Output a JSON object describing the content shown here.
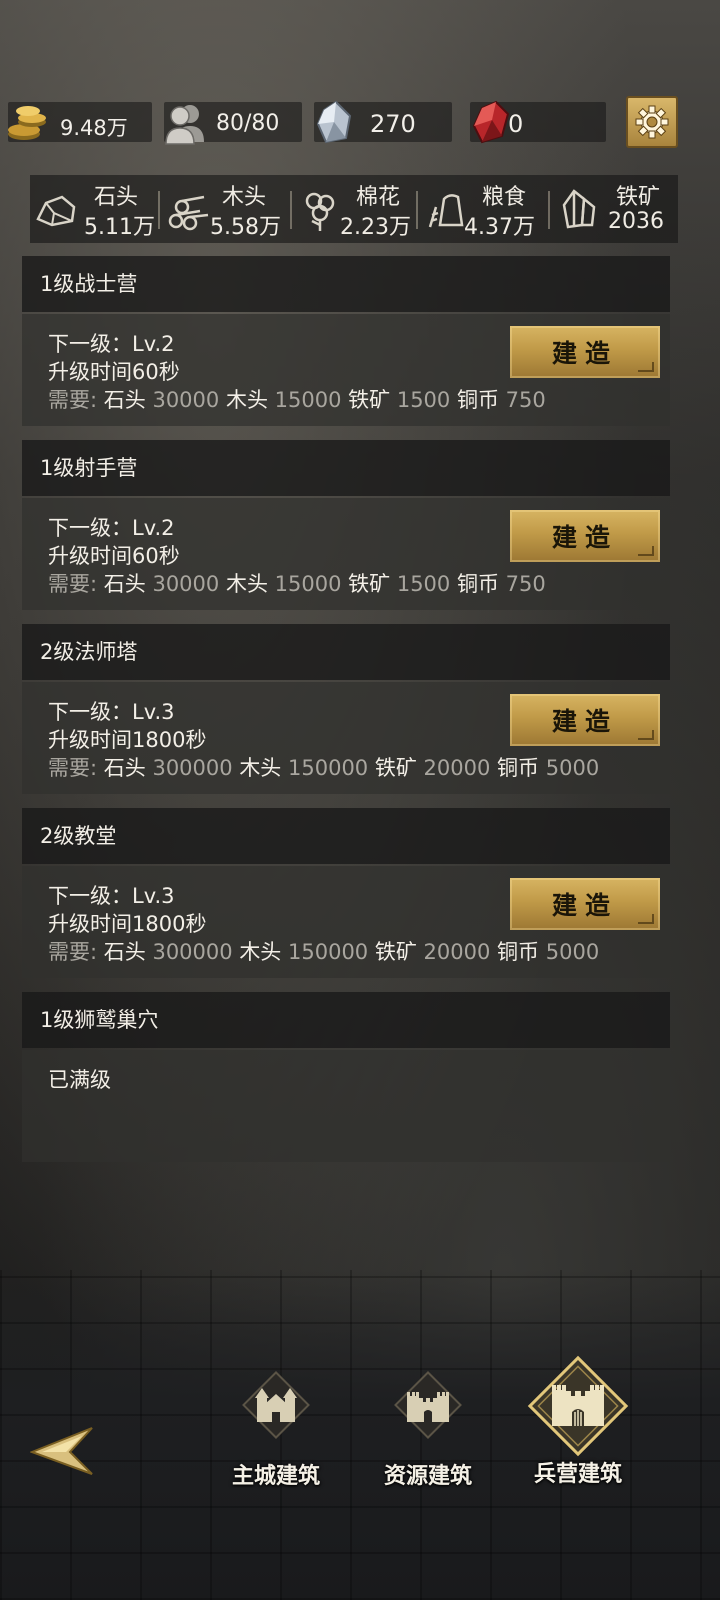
{
  "resources": {
    "coins": "9.48万",
    "population": "80/80",
    "crystal": "270",
    "ruby": "0"
  },
  "materials": [
    {
      "name": "石头",
      "value": "5.11万"
    },
    {
      "name": "木头",
      "value": "5.58万"
    },
    {
      "name": "棉花",
      "value": "2.23万"
    },
    {
      "name": "粮食",
      "value": "4.37万"
    },
    {
      "name": "铁矿",
      "value": "2036"
    }
  ],
  "buildings": [
    {
      "title": "1级战士营",
      "next": "下一级：Lv.2",
      "time": "升级时间60秒",
      "req_label": "需要:",
      "req": [
        [
          "石头",
          "30000"
        ],
        [
          "木头",
          "15000"
        ],
        [
          "铁矿",
          "1500"
        ],
        [
          "铜币",
          "750"
        ]
      ],
      "button": "建造"
    },
    {
      "title": "1级射手营",
      "next": "下一级：Lv.2",
      "time": "升级时间60秒",
      "req_label": "需要:",
      "req": [
        [
          "石头",
          "30000"
        ],
        [
          "木头",
          "15000"
        ],
        [
          "铁矿",
          "1500"
        ],
        [
          "铜币",
          "750"
        ]
      ],
      "button": "建造"
    },
    {
      "title": "2级法师塔",
      "next": "下一级：Lv.3",
      "time": "升级时间1800秒",
      "req_label": "需要:",
      "req": [
        [
          "石头",
          "300000"
        ],
        [
          "木头",
          "150000"
        ],
        [
          "铁矿",
          "20000"
        ],
        [
          "铜币",
          "5000"
        ]
      ],
      "button": "建造"
    },
    {
      "title": "2级教堂",
      "next": "下一级：Lv.3",
      "time": "升级时间1800秒",
      "req_label": "需要:",
      "req": [
        [
          "石头",
          "300000"
        ],
        [
          "木头",
          "150000"
        ],
        [
          "铁矿",
          "20000"
        ],
        [
          "铜币",
          "5000"
        ]
      ],
      "button": "建造"
    },
    {
      "title": "1级狮鹫巢穴",
      "status": "已满级"
    }
  ],
  "nav": {
    "tabs": [
      {
        "label": "主城建筑",
        "icon": "castle-icon"
      },
      {
        "label": "资源建筑",
        "icon": "fortress-icon"
      },
      {
        "label": "兵营建筑",
        "icon": "barracks-icon",
        "active": true
      }
    ]
  },
  "colors": {
    "gold": "#c9a24e",
    "card_head": "#181818",
    "card_body": "#30302e",
    "muted_text": "#a9a69f"
  }
}
